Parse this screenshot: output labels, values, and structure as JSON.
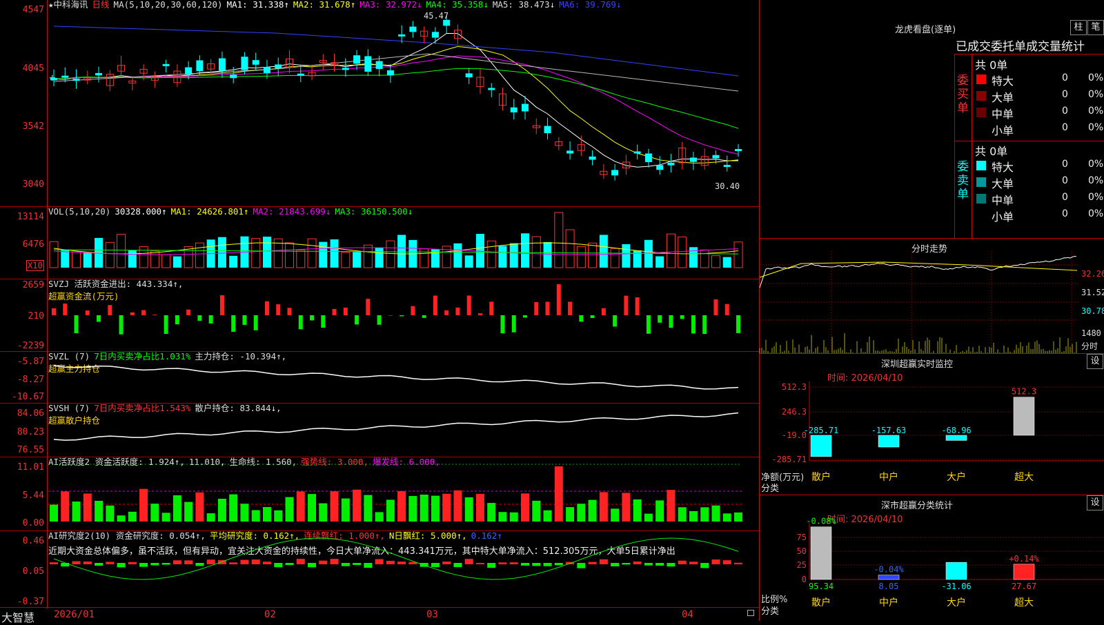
{
  "stock": {
    "name": "★中科海讯",
    "period": "日线"
  },
  "main": {
    "ma_header": [
      {
        "t": "MA(5,10,20,30,60,120)",
        "c": "#dddddd"
      },
      {
        "t": "MA1: 31.338↑",
        "c": "#ffffff"
      },
      {
        "t": "MA2: 31.678↑",
        "c": "#ffff00"
      },
      {
        "t": "MA3: 32.972↓",
        "c": "#ff00ff"
      },
      {
        "t": "MA4: 35.358↓",
        "c": "#00ff00"
      },
      {
        "t": "MA5: 38.473↓",
        "c": "#dddddd"
      },
      {
        "t": "MA6: 39.769↓",
        "c": "#3344ff"
      }
    ],
    "y_ticks": [
      "4547",
      "4045",
      "3542",
      "3040"
    ],
    "high_label": "45.47",
    "low_label": "30.40"
  },
  "vol": {
    "header": [
      {
        "t": "VOL(5,10,20)",
        "c": "#dddddd"
      },
      {
        "t": "30328.000↑",
        "c": "#ffffff"
      },
      {
        "t": "MA1: 24626.801↑",
        "c": "#ffff00"
      },
      {
        "t": "MA2: 21843.699↓",
        "c": "#ff00ff"
      },
      {
        "t": "MA3: 36150.500↓",
        "c": "#00ff00"
      }
    ],
    "y_ticks": [
      "13114",
      "6476"
    ],
    "unit": "X10"
  },
  "svzj": {
    "header": [
      {
        "t": "SVZJ  活跃资金进出: 443.334↑,",
        "c": "#dddddd"
      }
    ],
    "line2": "超赢资金流(万元)",
    "y_ticks": [
      "2659",
      "210",
      "-2239"
    ]
  },
  "svzl": {
    "header": [
      {
        "t": "SVZL (7)",
        "c": "#dddddd"
      },
      {
        "t": "7日内买卖净占比1.031%",
        "c": "#00ff00"
      },
      {
        "t": "主力持仓: -10.394↑,",
        "c": "#dddddd"
      }
    ],
    "line2": "超赢主力持仓",
    "y_ticks": [
      "-5.87",
      "-8.27",
      "-10.67"
    ]
  },
  "svsh": {
    "header": [
      {
        "t": "SVSH (7)",
        "c": "#dddddd"
      },
      {
        "t": "7日内买卖净占比1.543%",
        "c": "#ff3333"
      },
      {
        "t": "散户持仓: 83.844↓,",
        "c": "#dddddd"
      }
    ],
    "line2": "超赢散户持仓",
    "y_ticks": [
      "84.06",
      "80.23",
      "76.55"
    ]
  },
  "ai1": {
    "header": [
      {
        "t": "AI活跃度2 资金活跃度: 1.924↑,",
        "c": "#dddddd"
      },
      {
        "t": "11.010,",
        "c": "#dddddd"
      },
      {
        "t": "生命线: 1.560,",
        "c": "#dddddd"
      },
      {
        "t": "强势线: 3.000,",
        "c": "#ff3333"
      },
      {
        "t": "爆发线: 6.000,",
        "c": "#ff00ff"
      }
    ],
    "y_ticks": [
      "11.01",
      "5.44",
      "0.00"
    ]
  },
  "ai2": {
    "header": [
      {
        "t": "AI研究度2(10) 资金研究度: 0.054↑,",
        "c": "#dddddd"
      },
      {
        "t": "平均研究度: 0.162↑,",
        "c": "#ffff00"
      },
      {
        "t": "连续飘红: 1.000↑,",
        "c": "#ff3333"
      },
      {
        "t": "N日飘红: 5.000↑,",
        "c": "#ffff00"
      },
      {
        "t": "0.162↑",
        "c": "#3366ff"
      }
    ],
    "desc": "近期大资金总体偏多，虽不活跃，但有异动，宜关注大资金的持续性，今日大单净流入：443.341万元，其中特大单净流入：512.305万元，大单5日累计净出",
    "y_ticks": [
      "0.46",
      "0.05",
      "-0.37"
    ]
  },
  "xaxis": {
    "labels": [
      "2026/01",
      "02",
      "03",
      "04"
    ],
    "brand": "大智慧"
  },
  "right": {
    "lhb": {
      "title": "龙虎看盘(逐单)",
      "btn1": "柱",
      "btn2": "笔",
      "subtitle": "已成交委托单成交量统计",
      "buy": {
        "side": "委买单",
        "total": "共 0单",
        "rows": [
          {
            "label": "特大",
            "n": "0",
            "p": "0%",
            "c": "#ff0000"
          },
          {
            "label": "大单",
            "n": "0",
            "p": "0%",
            "c": "#8b0000"
          },
          {
            "label": "中单",
            "n": "0",
            "p": "0%",
            "c": "#6b0000"
          },
          {
            "label": "小单",
            "n": "0",
            "p": "0%",
            "c": "#000000"
          }
        ]
      },
      "sell": {
        "side": "委卖单",
        "total": "共 0单",
        "rows": [
          {
            "label": "特大",
            "n": "0",
            "p": "0%",
            "c": "#00ffff"
          },
          {
            "label": "大单",
            "n": "0",
            "p": "0%",
            "c": "#009999"
          },
          {
            "label": "中单",
            "n": "0",
            "p": "0%",
            "c": "#007777"
          },
          {
            "label": "小单",
            "n": "0",
            "p": "0%",
            "c": "#000000"
          }
        ]
      }
    },
    "fenshi": {
      "title": "分时走势",
      "y_ticks": [
        "32.26",
        "31.52",
        "30.78"
      ],
      "vol_tick": "1480",
      "vol_unit": "分时"
    },
    "monitor": {
      "title": "深圳超赢实时监控",
      "btn": "设",
      "date": "时间: 2026/04/10",
      "y_ticks": [
        "512.3",
        "246.3",
        "-19.0",
        "-285.71"
      ],
      "ylabel": "净额(万元)",
      "xlabel": "分类",
      "chart_data": {
        "type": "bar",
        "categories": [
          "散户",
          "中户",
          "大户",
          "超大"
        ],
        "values": [
          -285.71,
          -157.63,
          -68.96,
          512.3
        ]
      }
    },
    "classify": {
      "title": "深市超赢分类统计",
      "btn": "设",
      "date": "时间: 2026/04/10",
      "y_ticks": [
        "75",
        "50",
        "25",
        "0"
      ],
      "ylabel": "比例%",
      "xlabel": "分类",
      "chart_data": {
        "type": "bar",
        "categories": [
          "散户",
          "中户",
          "大户",
          "超大"
        ],
        "values": [
          95.34,
          8.05,
          -31.06,
          27.67
        ],
        "changes": [
          "-0.08%",
          "-0.04%",
          "",
          "+0.14%"
        ]
      }
    }
  }
}
